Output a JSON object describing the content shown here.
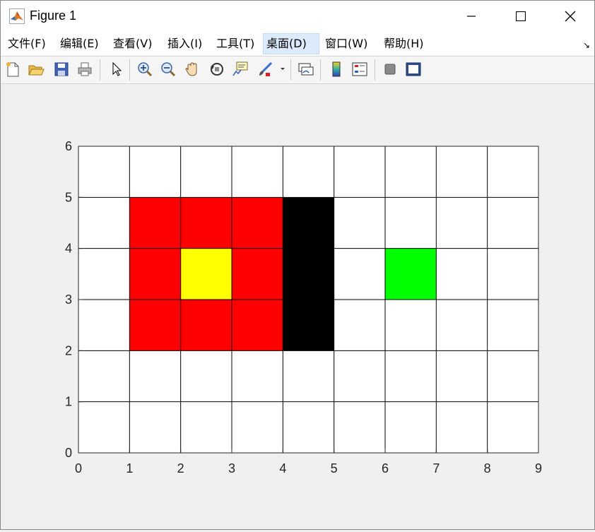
{
  "window": {
    "title": "Figure 1"
  },
  "menu": {
    "items": [
      {
        "label": "文件(F)",
        "active": false
      },
      {
        "label": "编辑(E)",
        "active": false
      },
      {
        "label": "查看(V)",
        "active": false
      },
      {
        "label": "插入(I)",
        "active": false
      },
      {
        "label": "工具(T)",
        "active": false
      },
      {
        "label": "桌面(D)",
        "active": true
      },
      {
        "label": "窗口(W)",
        "active": false
      },
      {
        "label": "帮助(H)",
        "active": false
      }
    ],
    "dock_arrow": "↘"
  },
  "toolbar": {
    "icons": [
      "new-figure-icon",
      "open-file-icon",
      "save-icon",
      "print-icon",
      "select-pointer-icon",
      "zoom-in-icon",
      "zoom-out-icon",
      "pan-hand-icon",
      "rotate-3d-icon",
      "data-cursor-icon",
      "brush-icon",
      "brush-dropdown-icon",
      "link-plot-icon",
      "colorbar-icon",
      "legend-icon",
      "hide-plot-tools-icon",
      "show-plot-tools-icon"
    ]
  },
  "chart_data": {
    "type": "heatmap",
    "xlim": [
      0,
      9
    ],
    "ylim": [
      0,
      6
    ],
    "xticks": [
      "0",
      "1",
      "2",
      "3",
      "4",
      "5",
      "6",
      "7",
      "8",
      "9"
    ],
    "yticks": [
      "0",
      "1",
      "2",
      "3",
      "4",
      "5",
      "6"
    ],
    "grid": true,
    "background": "#ffffff",
    "cells": [
      {
        "x": 1,
        "y": 2,
        "color": "#ff0000"
      },
      {
        "x": 1,
        "y": 3,
        "color": "#ff0000"
      },
      {
        "x": 1,
        "y": 4,
        "color": "#ff0000"
      },
      {
        "x": 2,
        "y": 2,
        "color": "#ff0000"
      },
      {
        "x": 2,
        "y": 3,
        "color": "#ffff00"
      },
      {
        "x": 2,
        "y": 4,
        "color": "#ff0000"
      },
      {
        "x": 3,
        "y": 2,
        "color": "#ff0000"
      },
      {
        "x": 3,
        "y": 3,
        "color": "#ff0000"
      },
      {
        "x": 3,
        "y": 4,
        "color": "#ff0000"
      },
      {
        "x": 4,
        "y": 2,
        "color": "#000000"
      },
      {
        "x": 4,
        "y": 3,
        "color": "#000000"
      },
      {
        "x": 4,
        "y": 4,
        "color": "#000000"
      },
      {
        "x": 6,
        "y": 3,
        "color": "#00ff00"
      }
    ]
  }
}
